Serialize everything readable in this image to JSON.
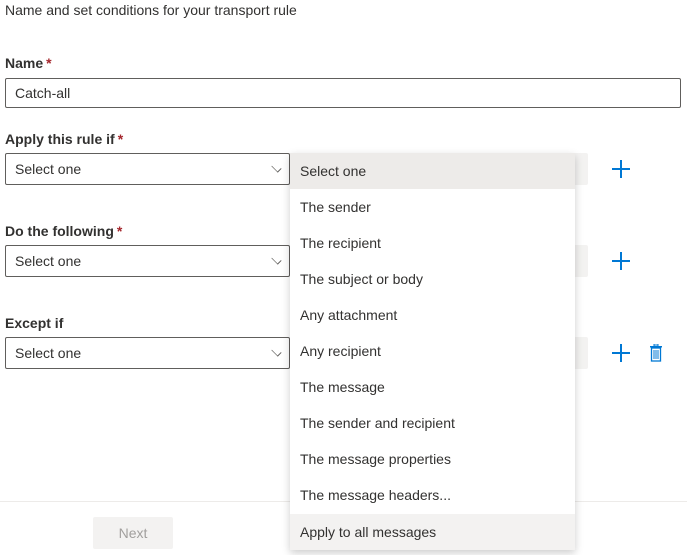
{
  "subtitle": "Name and set conditions for your transport rule",
  "name": {
    "label": "Name",
    "required": "*",
    "value": "Catch-all"
  },
  "apply": {
    "label": "Apply this rule if",
    "required": "*",
    "value": "Select one"
  },
  "do": {
    "label": "Do the following",
    "required": "*",
    "value": "Select one"
  },
  "except": {
    "label": "Except if",
    "value": "Select one"
  },
  "next_label": "Next",
  "accent": "#0078d4",
  "menu": {
    "items": [
      "Select one",
      "The sender",
      "The recipient",
      "The subject or body",
      "Any attachment",
      "Any recipient",
      "The message",
      "The sender and recipient",
      "The message properties",
      "The message headers...",
      "Apply to all messages"
    ]
  }
}
